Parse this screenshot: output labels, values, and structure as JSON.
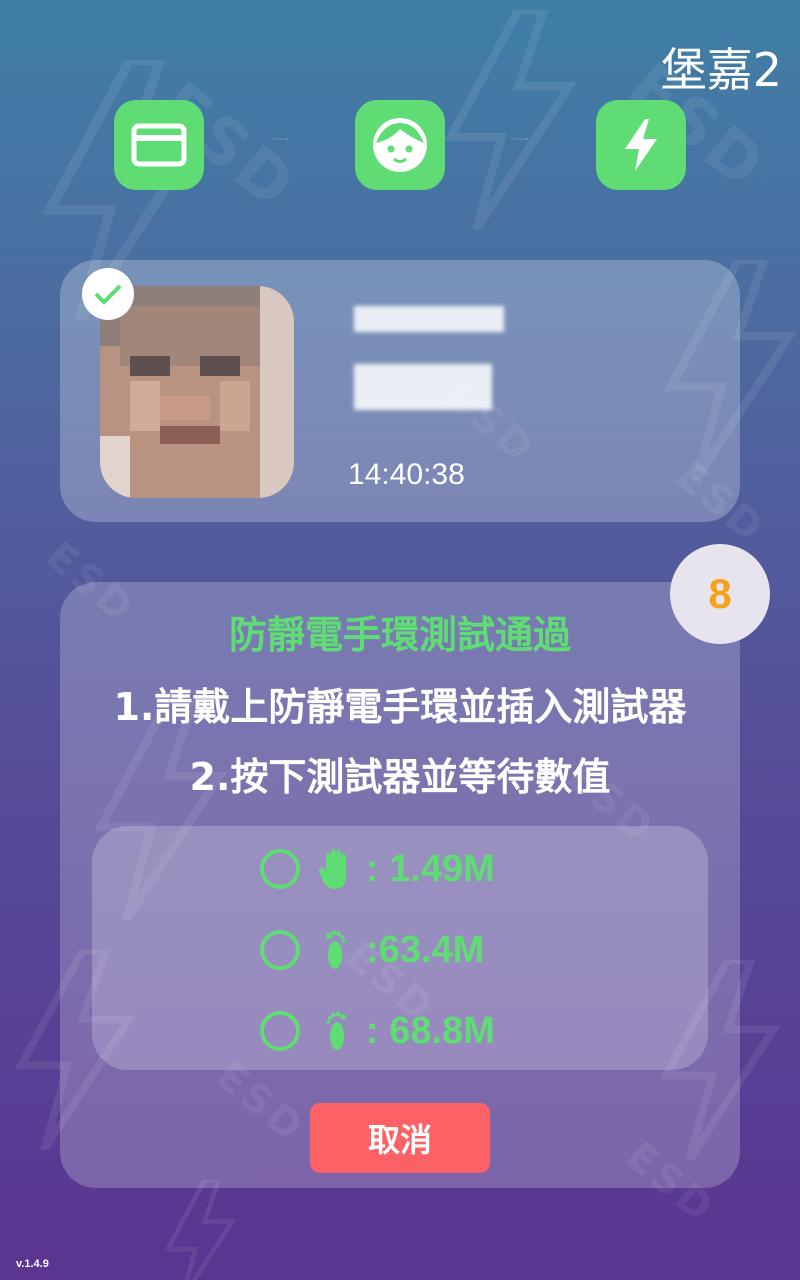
{
  "header": {
    "site_label": "堡嘉2"
  },
  "steps": [
    {
      "name": "card",
      "icon": "id-card-icon"
    },
    {
      "name": "face",
      "icon": "face-icon"
    },
    {
      "name": "esd",
      "icon": "lightning-icon"
    }
  ],
  "user": {
    "verified_icon": "checkmark-icon",
    "time": "14:40:38"
  },
  "test": {
    "countdown": "8",
    "status": "防靜電手環測試通過",
    "instruction_1": "1.請戴上防靜電手環並插入測試器",
    "instruction_2": "2.按下測試器並等待數值",
    "results": [
      {
        "icon": "hand-icon",
        "value": ": 1.49M"
      },
      {
        "icon": "left-foot-icon",
        "value": ":63.4M"
      },
      {
        "icon": "right-foot-icon",
        "value": ": 68.8M"
      }
    ],
    "cancel_label": "取消"
  },
  "footer": {
    "version": "v.1.4.9"
  },
  "colors": {
    "accent_green": "#5fdc73",
    "cancel_red": "#fb6165",
    "countdown_orange": "#f5a21a"
  }
}
